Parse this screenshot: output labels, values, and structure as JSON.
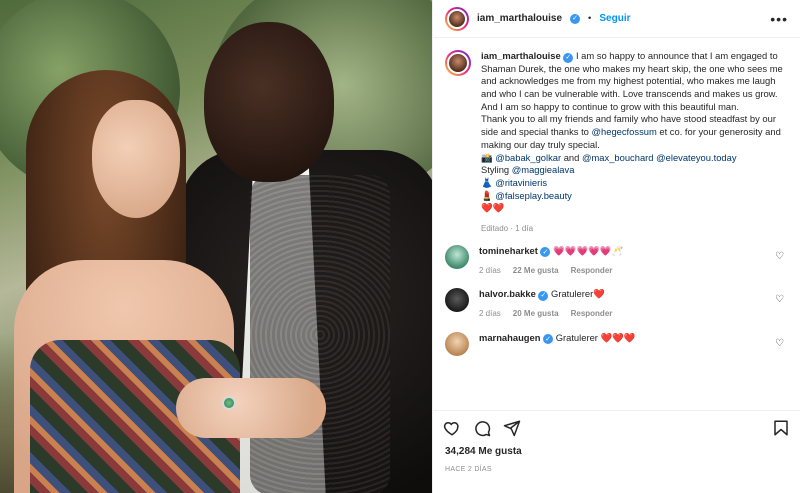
{
  "header": {
    "username": "iam_marthalouise",
    "separator": "•",
    "follow_label": "Seguir",
    "more_label": "•••"
  },
  "caption": {
    "username": "iam_marthalouise",
    "line1": "I am so happy to announce that I am engaged to Shaman Durek, the one who makes my heart skip, the one who sees me and acknowledges me from my highest potential, who makes me laugh and who I can be vulnerable with. Love transcends and makes us grow. And I am so happy to continue to grow with this beautiful man.",
    "line2_prefix": "Thank you to all my friends and family who have stood steadfast by our side and special thanks to ",
    "mention_hegec": "@hegecfossum",
    "line2_suffix": " et co. for your generosity and making our day truly special.",
    "camera_emoji": "📸",
    "mention_babak": "@babak_golkar",
    "and": " and ",
    "mention_max": "@max_bouchard",
    "mention_elevate": "@elevateyou.today",
    "styling": "Styling ",
    "mention_maggie": "@maggiealava",
    "dress_emoji": "👗",
    "mention_rita": "@ritavinieris",
    "lipstick_emoji": "💄",
    "mention_falseplay": "@falseplay.beauty",
    "hearts": "❤️❤️",
    "meta": "Editado · 1 día"
  },
  "comments": [
    {
      "username": "tomineharket",
      "text": "💗💗💗💗💗🥂",
      "age": "2 días",
      "likes": "22 Me gusta",
      "reply": "Responder"
    },
    {
      "username": "halvor.bakke",
      "text": "Gratulerer❤️",
      "age": "2 días",
      "likes": "20 Me gusta",
      "reply": "Responder"
    },
    {
      "username": "marnahaugen",
      "text": "Gratulerer ❤️❤️❤️",
      "age": "",
      "likes": "",
      "reply": ""
    }
  ],
  "stats": {
    "likes": "34,284 Me gusta",
    "date": "HACE 2 DÍAS"
  },
  "colors": {
    "link": "#0095f6",
    "mention": "#00376b",
    "muted": "#8e8e8e",
    "verified": "#3897f0"
  }
}
